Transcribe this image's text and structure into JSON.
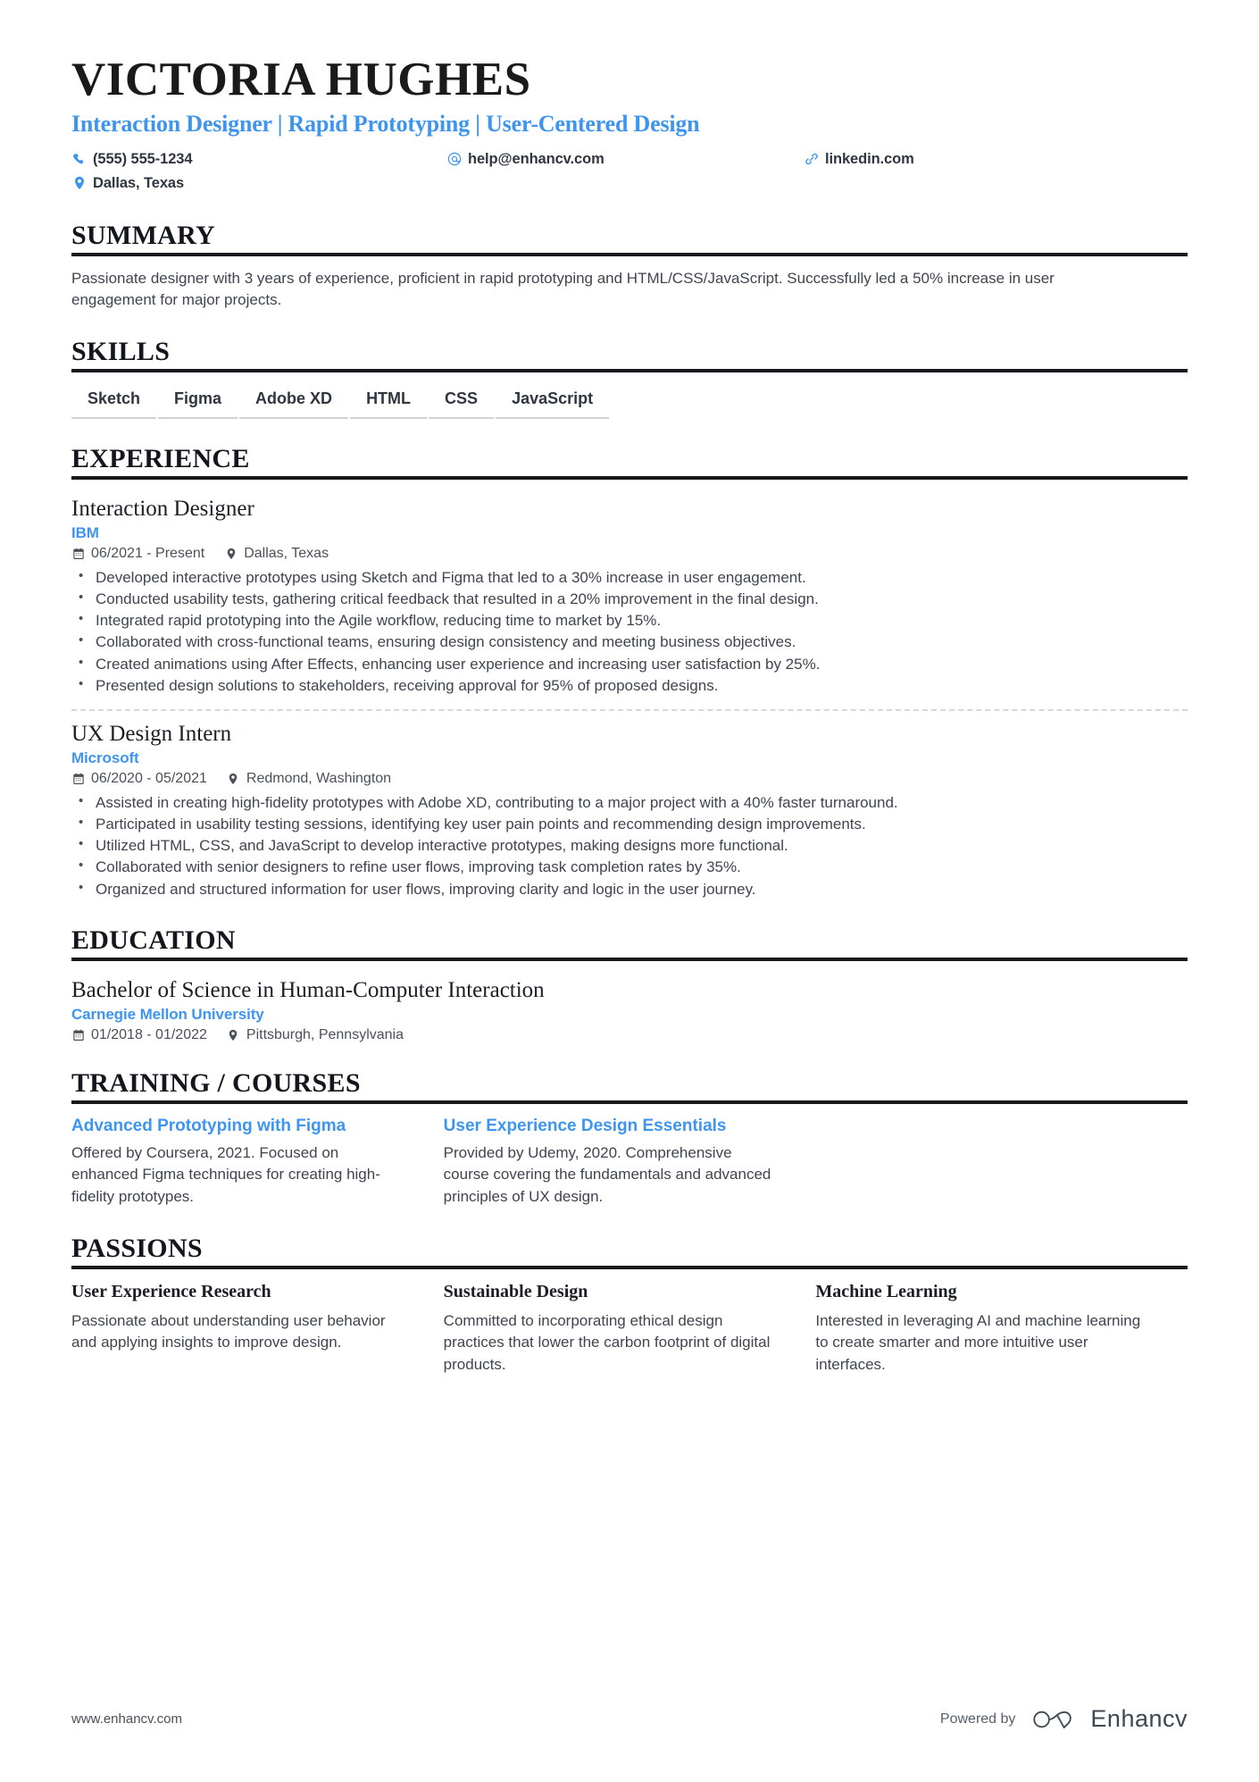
{
  "accent_color": "#3e95f0",
  "rule_color": "#17191c",
  "header": {
    "name": "VICTORIA HUGHES",
    "headline": "Interaction Designer | Rapid Prototyping | User-Centered Design",
    "contacts": [
      {
        "icon": "phone-icon",
        "value": "(555) 555-1234"
      },
      {
        "icon": "email-icon",
        "value": "help@enhancv.com"
      },
      {
        "icon": "link-icon",
        "value": "linkedin.com"
      },
      {
        "icon": "location-icon",
        "value": "Dallas, Texas"
      }
    ]
  },
  "summary": {
    "title": "SUMMARY",
    "text": "Passionate designer with 3 years of experience, proficient in rapid prototyping and HTML/CSS/JavaScript. Successfully led a 50% increase in user engagement for major projects."
  },
  "skills": {
    "title": "SKILLS",
    "items": [
      "Sketch",
      "Figma",
      "Adobe XD",
      "HTML",
      "CSS",
      "JavaScript"
    ]
  },
  "experience": {
    "title": "EXPERIENCE",
    "entries": [
      {
        "role": "Interaction Designer",
        "company": "IBM",
        "dates": "06/2021 - Present",
        "location": "Dallas, Texas",
        "bullets": [
          "Developed interactive prototypes using Sketch and Figma that led to a 30% increase in user engagement.",
          "Conducted usability tests, gathering critical feedback that resulted in a 20% improvement in the final design.",
          "Integrated rapid prototyping into the Agile workflow, reducing time to market by 15%.",
          "Collaborated with cross-functional teams, ensuring design consistency and meeting business objectives.",
          "Created animations using After Effects, enhancing user experience and increasing user satisfaction by 25%.",
          "Presented design solutions to stakeholders, receiving approval for 95% of proposed designs."
        ]
      },
      {
        "role": "UX Design Intern",
        "company": "Microsoft",
        "dates": "06/2020 - 05/2021",
        "location": "Redmond, Washington",
        "bullets": [
          "Assisted in creating high-fidelity prototypes with Adobe XD, contributing to a major project with a 40% faster turnaround.",
          "Participated in usability testing sessions, identifying key user pain points and recommending design improvements.",
          "Utilized HTML, CSS, and JavaScript to develop interactive prototypes, making designs more functional.",
          "Collaborated with senior designers to refine user flows, improving task completion rates by 35%.",
          "Organized and structured information for user flows, improving clarity and logic in the user journey."
        ]
      }
    ]
  },
  "education": {
    "title": "EDUCATION",
    "entries": [
      {
        "degree": "Bachelor of Science in Human-Computer Interaction",
        "school": "Carnegie Mellon University",
        "dates": "01/2018 - 01/2022",
        "location": "Pittsburgh, Pennsylvania"
      }
    ]
  },
  "training": {
    "title": "TRAINING / COURSES",
    "items": [
      {
        "name": "Advanced Prototyping with Figma",
        "description": "Offered by Coursera, 2021. Focused on enhanced Figma techniques for creating high-fidelity prototypes."
      },
      {
        "name": "User Experience Design Essentials",
        "description": "Provided by Udemy, 2020. Comprehensive course covering the fundamentals and advanced principles of UX design."
      }
    ]
  },
  "passions": {
    "title": "PASSIONS",
    "items": [
      {
        "name": "User Experience Research",
        "description": "Passionate about understanding user behavior and applying insights to improve design."
      },
      {
        "name": "Sustainable Design",
        "description": "Committed to incorporating ethical design practices that lower the carbon footprint of digital products."
      },
      {
        "name": "Machine Learning",
        "description": "Interested in leveraging AI and machine learning to create smarter and more intuitive user interfaces."
      }
    ]
  },
  "footer": {
    "url": "www.enhancv.com",
    "powered_by": "Powered by",
    "brand": "Enhancv"
  }
}
